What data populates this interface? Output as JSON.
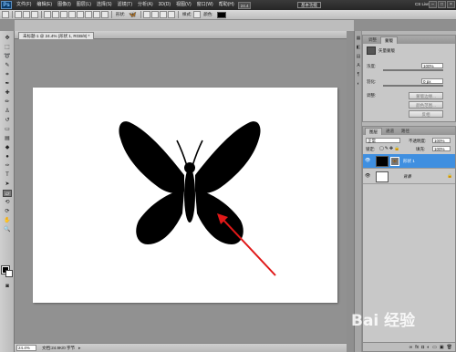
{
  "menubar": {
    "logo": "Ps",
    "items": [
      "文件(F)",
      "编辑(E)",
      "图像(I)",
      "图层(L)",
      "选择(S)",
      "滤镜(T)",
      "分析(A)",
      "3D(D)",
      "视图(V)",
      "窗口(W)",
      "帮助(H)"
    ],
    "zoom_dropdown": "24.4",
    "workspace_button": "基本功能",
    "cslive": "CS Live"
  },
  "optionsbar": {
    "style_label": "样式:",
    "color_label": "颜色:",
    "shape_label": "形状:"
  },
  "document": {
    "tab_title": "未标题-1 @ 24.4% (形状 1, RGB/8) *",
    "zoom": "24.4%",
    "doc_info": "文档:24.9K/0 字节"
  },
  "masks_panel": {
    "tabs": [
      "调整",
      "蒙版"
    ],
    "title": "矢量蒙版",
    "density_label": "浓度:",
    "density_value": "100%",
    "feather_label": "羽化:",
    "feather_value": "0 px",
    "refine_label": "调整:",
    "buttons": [
      "蒙版边缘...",
      "颜色范围...",
      "反相"
    ]
  },
  "layers_panel": {
    "tabs": [
      "图层",
      "通道",
      "路径"
    ],
    "blend_mode": "正常",
    "opacity_label": "不透明度:",
    "opacity_value": "100%",
    "lock_label": "锁定:",
    "fill_label": "填充:",
    "fill_value": "100%",
    "layers": [
      {
        "name": "形状 1",
        "selected": true
      },
      {
        "name": "背景",
        "selected": false
      }
    ]
  },
  "watermark": "Bai 经验",
  "colors": {
    "selected_layer": "#3f8fe0",
    "arrow": "#e01818",
    "shape_fill": "#000000"
  }
}
